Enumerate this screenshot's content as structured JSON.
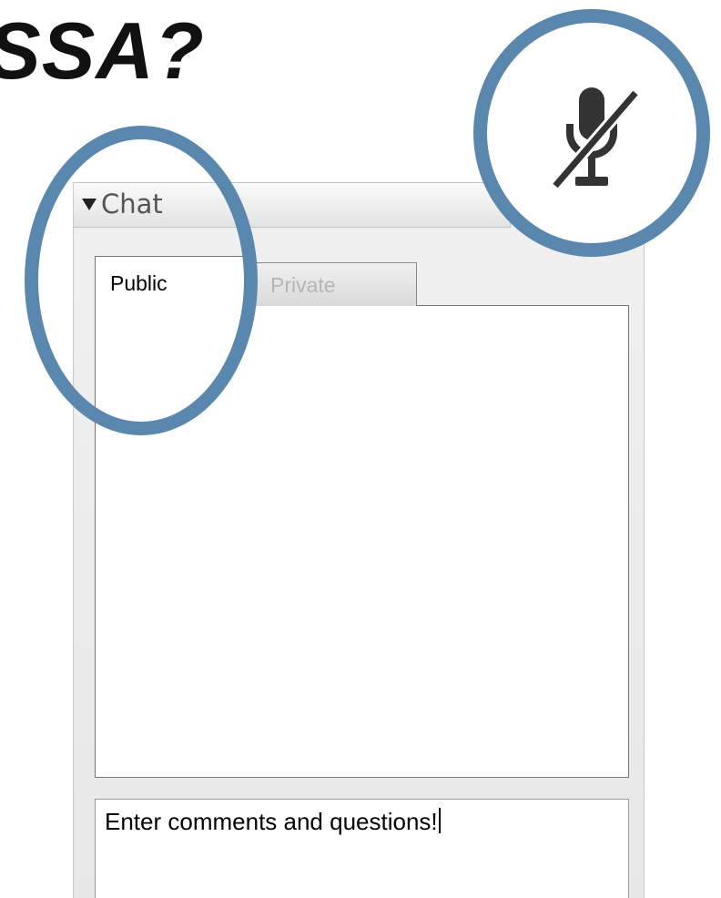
{
  "page_title": "SSA?",
  "chat": {
    "header_title": "Chat",
    "tabs": [
      {
        "label": "Public",
        "active": true
      },
      {
        "label": "Private",
        "active": false
      }
    ],
    "input_value": "Enter comments and questions!"
  },
  "icons": {
    "collapse": "triangle-down-icon",
    "microphone": "microphone-muted-icon"
  },
  "colors": {
    "highlight": "#5a87ad"
  }
}
